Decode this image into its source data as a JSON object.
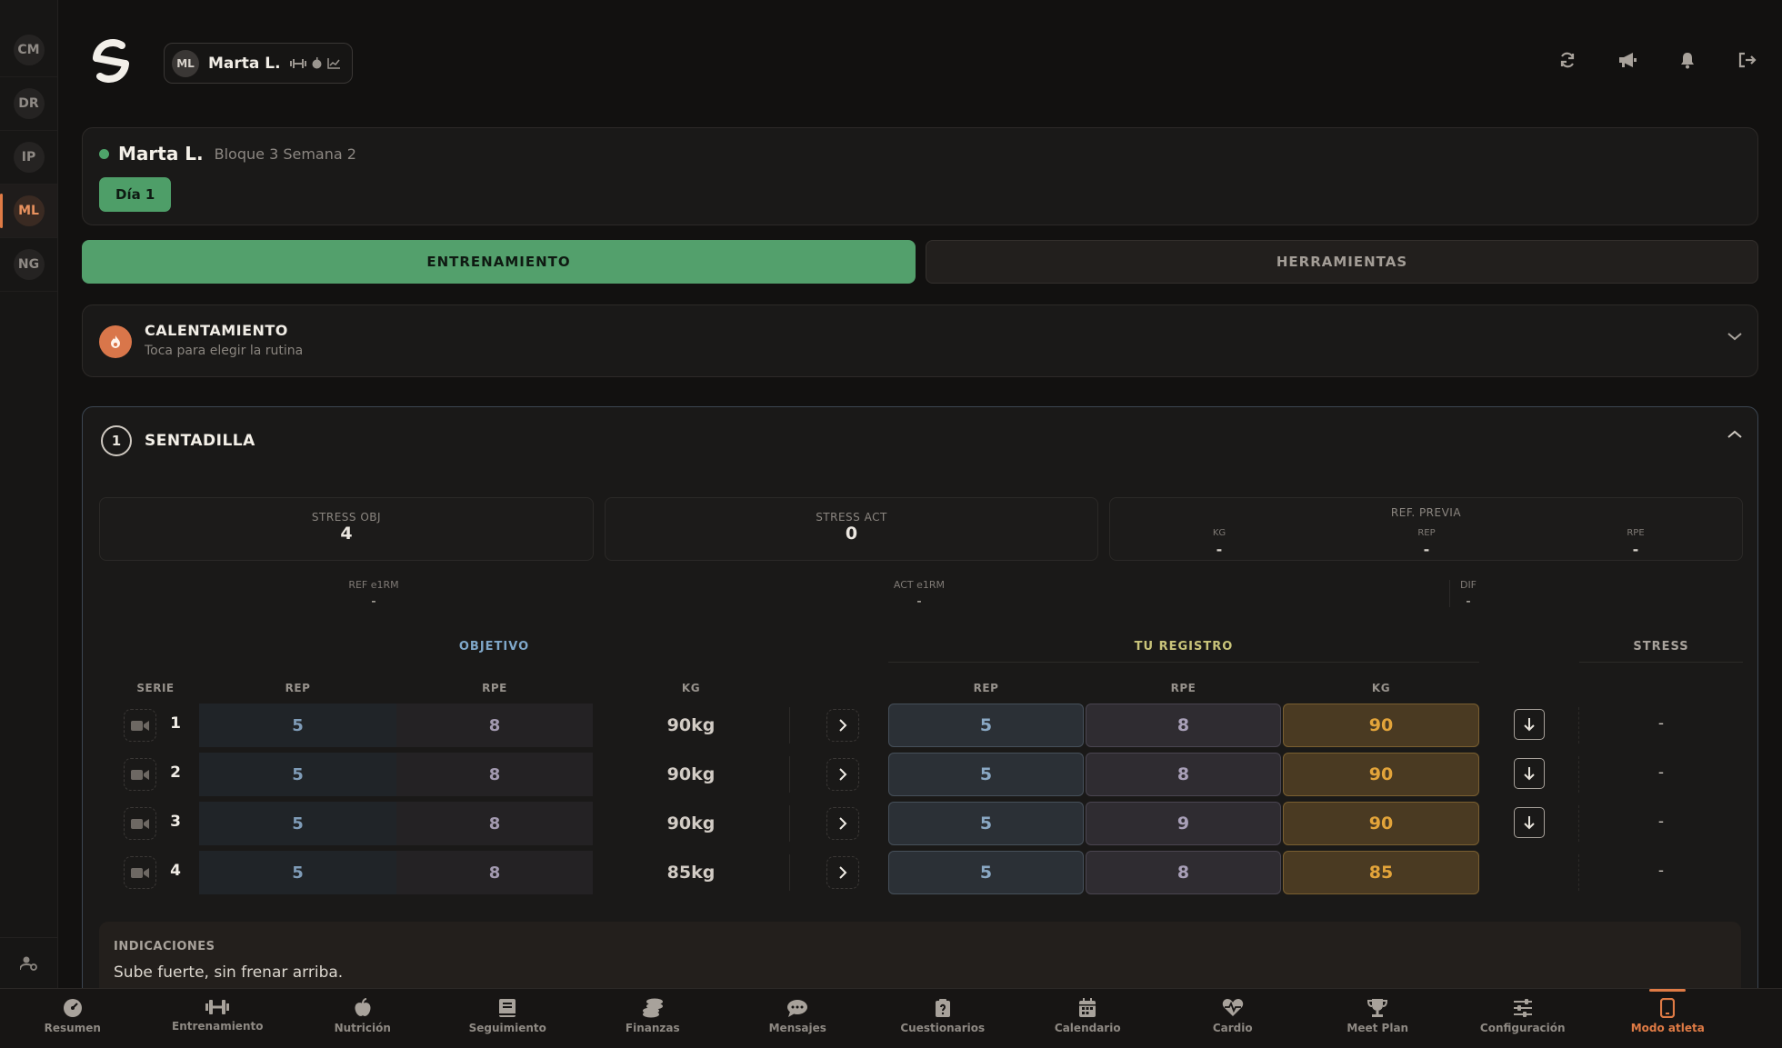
{
  "rail": {
    "clients": [
      {
        "initials": "CM",
        "active": false
      },
      {
        "initials": "DR",
        "active": false
      },
      {
        "initials": "IP",
        "active": false
      },
      {
        "initials": "ML",
        "active": true
      },
      {
        "initials": "NG",
        "active": false
      }
    ]
  },
  "header": {
    "user_initials": "ML",
    "user_name": "Marta L.",
    "chip_icons": [
      "dumbbell-icon",
      "apple-icon",
      "chart-line-icon"
    ],
    "actions": [
      "refresh-icon",
      "megaphone-icon",
      "bell-icon",
      "logout-icon"
    ]
  },
  "athlete": {
    "name": "Marta L.",
    "block": "Bloque 3 Semana 2",
    "day": "Día 1",
    "status_color": "#4ea46a"
  },
  "tabs": {
    "training": "ENTRENAMIENTO",
    "tools": "HERRAMIENTAS"
  },
  "warmup": {
    "title": "CALENTAMIENTO",
    "subtitle": "Toca para elegir la rutina"
  },
  "exercise": {
    "number": "1",
    "name": "SENTADILLA",
    "stress_obj_label": "STRESS OBJ",
    "stress_obj": "4",
    "stress_act_label": "STRESS ACT",
    "stress_act": "0",
    "ref_previa_label": "REF. PREVIA",
    "ref_kg_label": "KG",
    "ref_kg": "-",
    "ref_rep_label": "REP",
    "ref_rep": "-",
    "ref_rpe_label": "RPE",
    "ref_rpe": "-",
    "ref_e1rm_label": "REF e1RM",
    "ref_e1rm": "-",
    "act_e1rm_label": "ACT e1RM",
    "act_e1rm": "-",
    "dif_label": "DIF",
    "dif": "-",
    "objetivo_label": "OBJETIVO",
    "registro_label": "TU REGISTRO",
    "stress_label": "STRESS",
    "col_serie": "SERIE",
    "col_rep": "REP",
    "col_rpe": "RPE",
    "col_kg": "KG",
    "sets": [
      {
        "serie": "1",
        "obj_rep": "5",
        "obj_rpe": "8",
        "obj_kg": "90kg",
        "reg_rep": "5",
        "reg_rpe": "8",
        "reg_kg": "90",
        "stress": "-",
        "can_copy_down": true
      },
      {
        "serie": "2",
        "obj_rep": "5",
        "obj_rpe": "8",
        "obj_kg": "90kg",
        "reg_rep": "5",
        "reg_rpe": "8",
        "reg_kg": "90",
        "stress": "-",
        "can_copy_down": true
      },
      {
        "serie": "3",
        "obj_rep": "5",
        "obj_rpe": "8",
        "obj_kg": "90kg",
        "reg_rep": "5",
        "reg_rpe": "9",
        "reg_kg": "90",
        "stress": "-",
        "can_copy_down": true
      },
      {
        "serie": "4",
        "obj_rep": "5",
        "obj_rpe": "8",
        "obj_kg": "85kg",
        "reg_rep": "5",
        "reg_rpe": "8",
        "reg_kg": "85",
        "stress": "-",
        "can_copy_down": false
      }
    ],
    "notes_label": "INDICACIONES",
    "notes_text": "Sube fuerte, sin frenar arriba."
  },
  "bottom_nav": [
    {
      "label": "Resumen",
      "icon": "gauge-icon",
      "active": false
    },
    {
      "label": "Entrenamiento",
      "icon": "dumbbell-icon",
      "active": false
    },
    {
      "label": "Nutrición",
      "icon": "apple-icon",
      "active": false
    },
    {
      "label": "Seguimiento",
      "icon": "book-icon",
      "active": false
    },
    {
      "label": "Finanzas",
      "icon": "coins-icon",
      "active": false
    },
    {
      "label": "Mensajes",
      "icon": "chat-icon",
      "active": false
    },
    {
      "label": "Cuestionarios",
      "icon": "clipboard-question-icon",
      "active": false
    },
    {
      "label": "Calendario",
      "icon": "calendar-icon",
      "active": false
    },
    {
      "label": "Cardio",
      "icon": "heart-pulse-icon",
      "active": false
    },
    {
      "label": "Meet Plan",
      "icon": "trophy-icon",
      "active": false
    },
    {
      "label": "Configuración",
      "icon": "sliders-icon",
      "active": false
    },
    {
      "label": "Modo atleta",
      "icon": "mobile-icon",
      "active": true
    }
  ],
  "colors": {
    "accent_green": "#53a06c",
    "accent_orange": "#e07b45",
    "kg_gold": "#e3a43a",
    "objetivo_blue": "#7fa7c9",
    "registro_yellow": "#c9c47a"
  }
}
